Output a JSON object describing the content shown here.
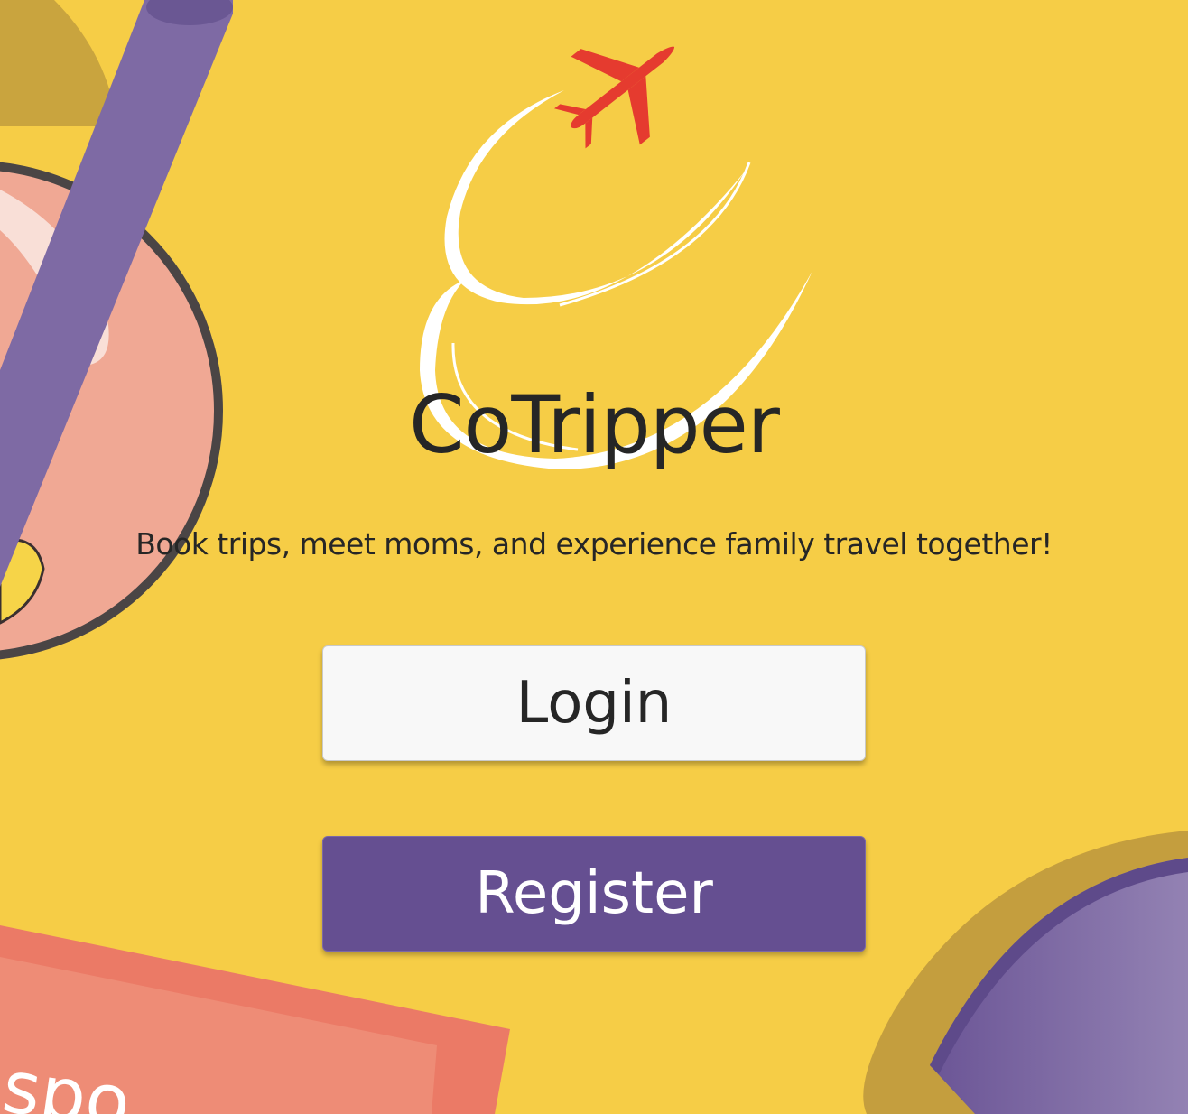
{
  "app": {
    "title": "CoTripper",
    "tagline": "Book trips, meet moms, and experience family travel together!"
  },
  "actions": {
    "login_label": "Login",
    "register_label": "Register"
  },
  "icons": {
    "logo": "airplane-swirl-logo-icon"
  },
  "colors": {
    "background": "#f6cd46",
    "accent_purple": "#654f91",
    "plane_red": "#e53b2f",
    "coral": "#ec8a76"
  }
}
